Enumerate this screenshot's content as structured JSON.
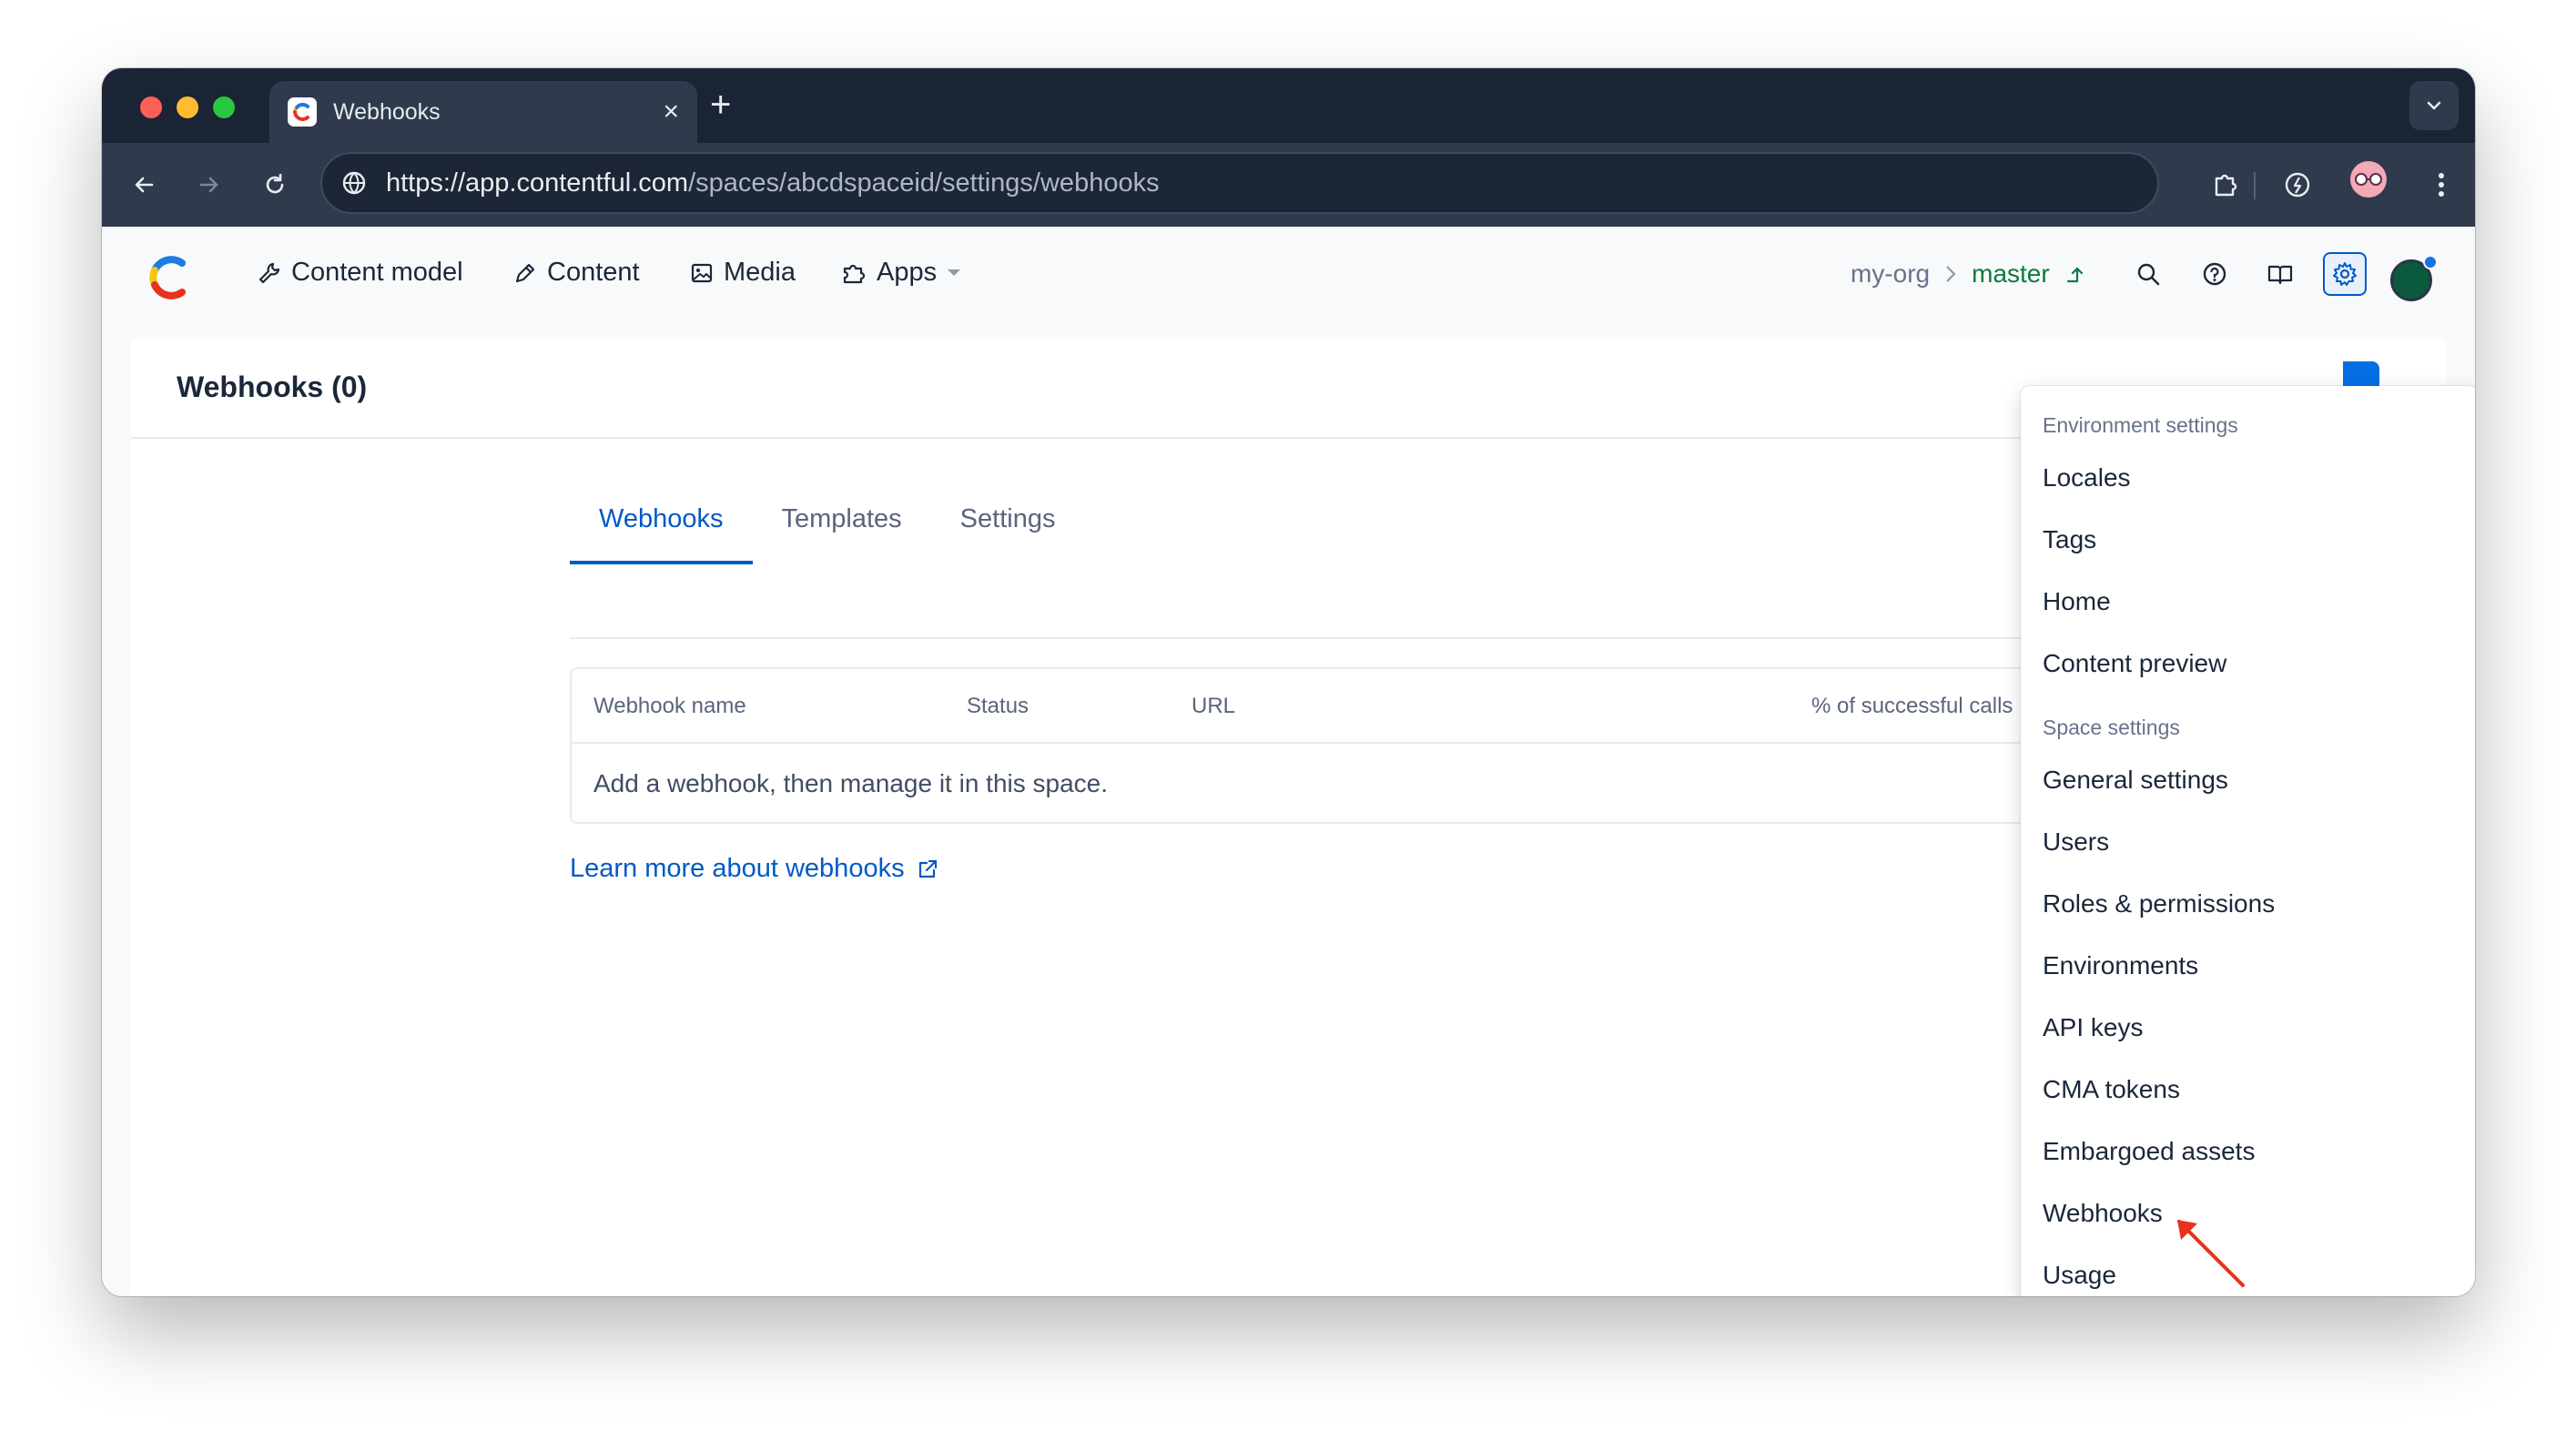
{
  "browser": {
    "tab_title": "Webhooks",
    "url_host": "https://app.contentful.com",
    "url_path": "/spaces/abcdspaceid/settings/webhooks"
  },
  "nav": {
    "items": [
      {
        "label": "Content model",
        "icon": "wrench-icon"
      },
      {
        "label": "Content",
        "icon": "pen-icon"
      },
      {
        "label": "Media",
        "icon": "image-icon"
      },
      {
        "label": "Apps",
        "icon": "puzzle-icon"
      }
    ],
    "org": "my-org",
    "environment": "master"
  },
  "page": {
    "title": "Webhooks (0)",
    "tabs": [
      "Webhooks",
      "Templates",
      "Settings"
    ],
    "table": {
      "columns": [
        "Webhook name",
        "Status",
        "URL",
        "% of successful calls"
      ],
      "empty_message": "Add a webhook, then manage it in this space."
    },
    "learn_more": "Learn more about webhooks"
  },
  "settings_menu": {
    "sections": [
      {
        "title": "Environment settings",
        "items": [
          "Locales",
          "Tags",
          "Home",
          "Content preview"
        ]
      },
      {
        "title": "Space settings",
        "items": [
          "General settings",
          "Users",
          "Roles & permissions",
          "Environments",
          "API keys",
          "CMA tokens",
          "Embargoed assets",
          "Webhooks",
          "Usage"
        ]
      }
    ]
  },
  "colors": {
    "accent": "#0059c8",
    "environment": "#0e7a40",
    "annotation_arrow": "#e8321d"
  }
}
